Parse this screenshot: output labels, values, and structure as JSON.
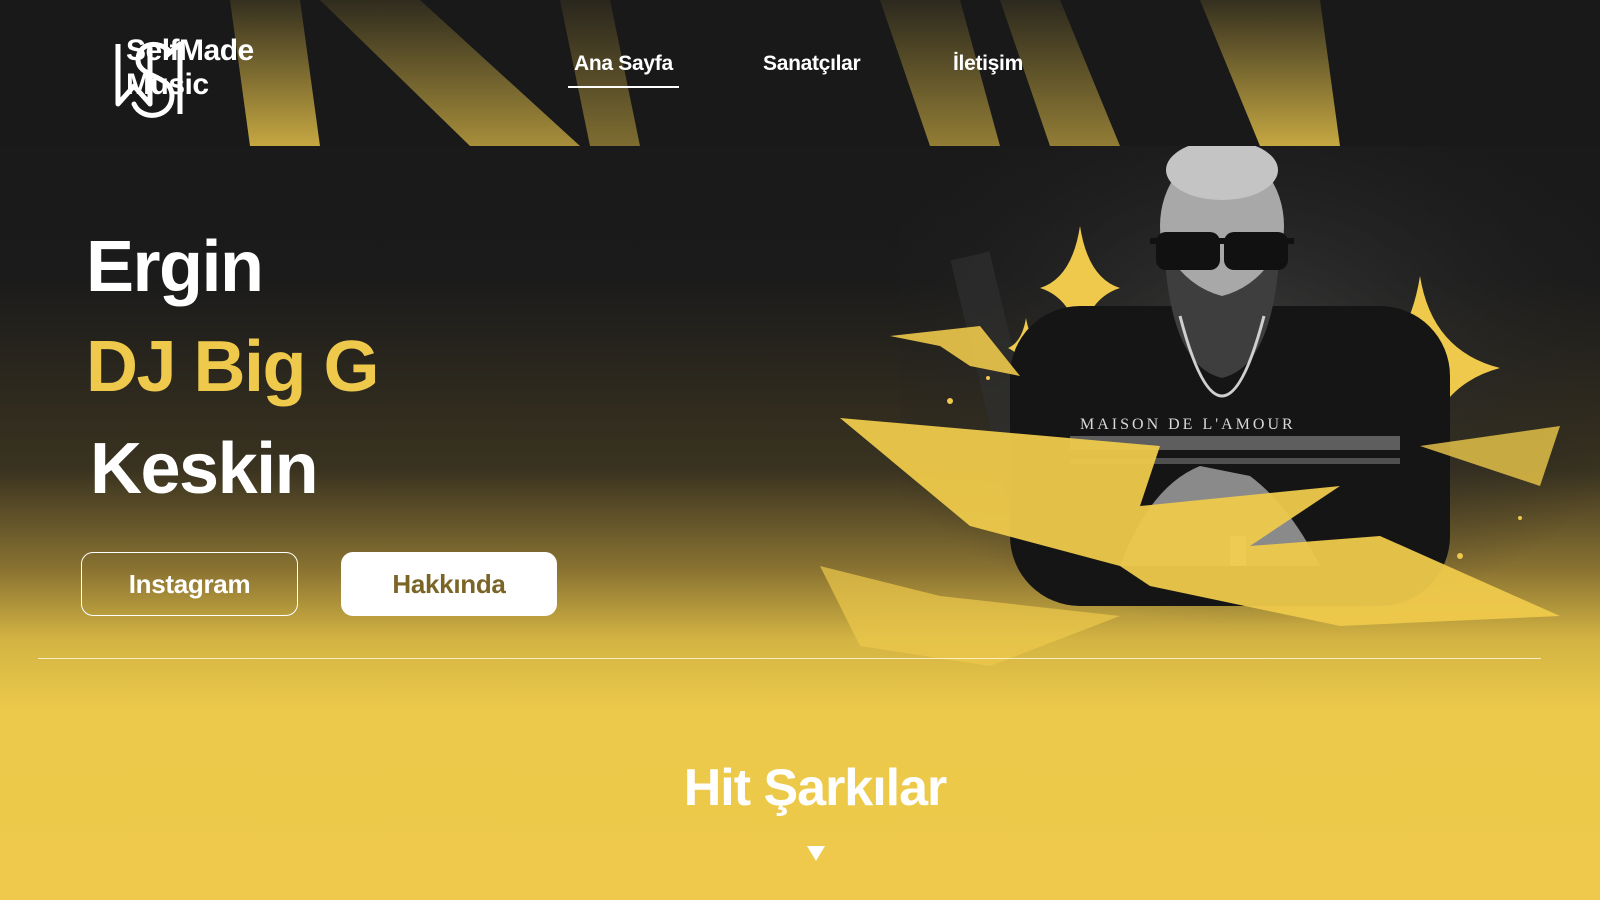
{
  "brand": {
    "name_line1": "SelfMade",
    "name_line2": "Music",
    "logo_icon": "sm-monogram-icon"
  },
  "nav": {
    "items": [
      {
        "label": "Ana Sayfa",
        "active": true
      },
      {
        "label": "Sanatçılar",
        "active": false
      },
      {
        "label": "İletişim",
        "active": false
      }
    ]
  },
  "hero": {
    "first_name": "Ergin",
    "stage_name": "DJ Big G",
    "last_name": "Keskin",
    "instagram_label": "Instagram",
    "about_label": "Hakkında",
    "portrait": "artist-portrait-image",
    "shirt_text": "MAISON DE L'AMOUR"
  },
  "section": {
    "title": "Hit Şarkılar",
    "arrow_icon": "triangle-down-icon"
  },
  "colors": {
    "accent": "#eec94b",
    "dark": "#1a1a1a",
    "button_text": "#7a6526",
    "white": "#ffffff"
  }
}
